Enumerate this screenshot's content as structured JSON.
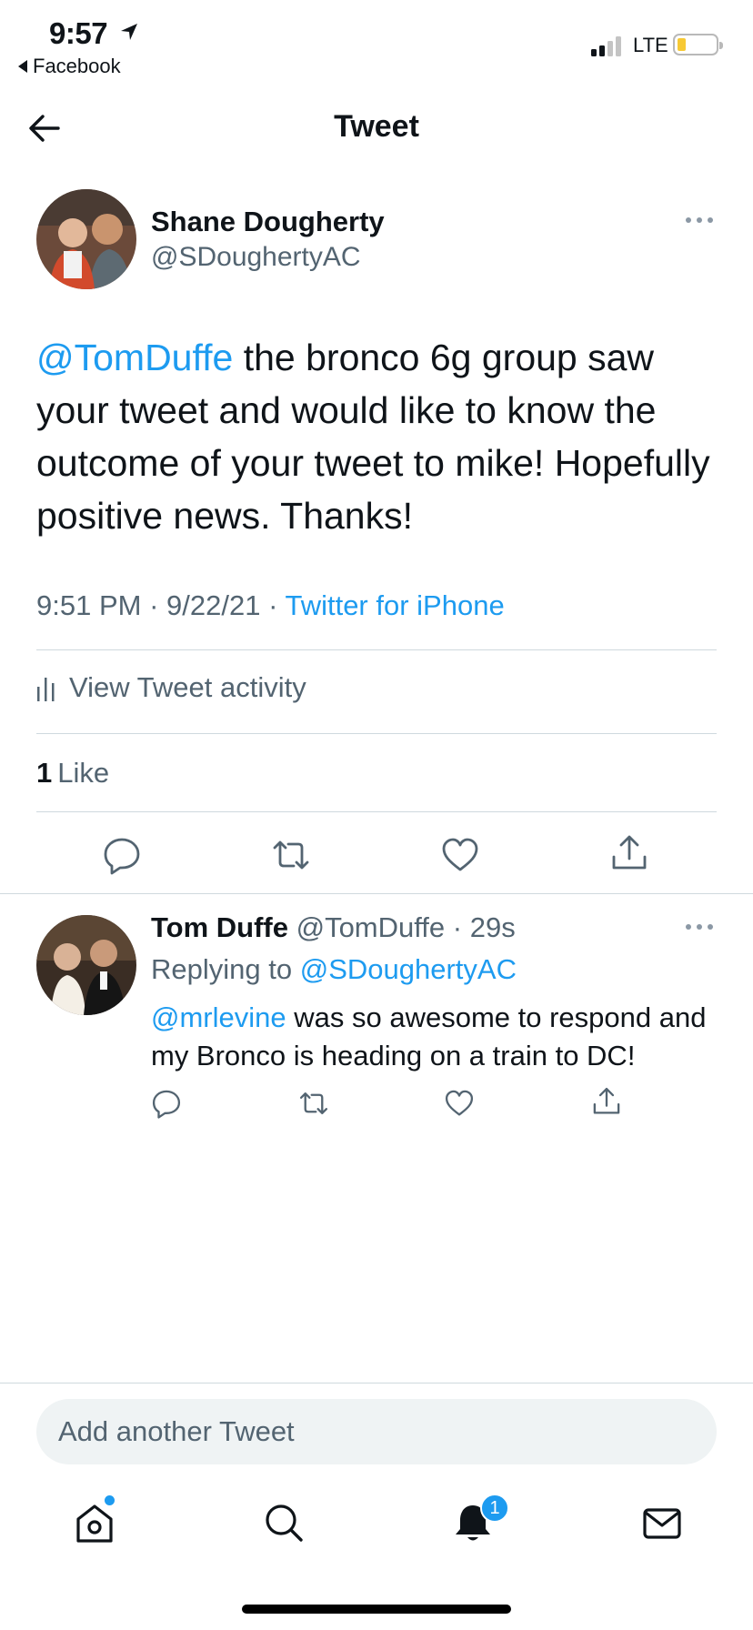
{
  "status_bar": {
    "time": "9:57",
    "back_app": "Facebook",
    "network": "LTE",
    "battery_level": 0.2,
    "battery_color": "#f7c934"
  },
  "nav": {
    "title": "Tweet",
    "back_icon": "arrow-left-icon"
  },
  "main_tweet": {
    "author_name": "Shane Dougherty",
    "author_handle": "@SDoughertyAC",
    "text_mention": "@TomDuffe",
    "text_body": " the bronco 6g group saw your tweet and would like to know the outcome of your tweet to mike! Hopefully positive news. Thanks!",
    "time": "9:51 PM",
    "date": "9/22/21",
    "source": "Twitter for iPhone",
    "activity_label": "View Tweet activity",
    "like_count": "1",
    "like_label": "Like"
  },
  "reply": {
    "author_name": "Tom Duffe",
    "author_handle": "@TomDuffe",
    "time": "29s",
    "replying_prefix": "Replying to ",
    "replying_to": "@SDoughertyAC",
    "text_mention": "@mrlevine",
    "text_body": " was so awesome to respond and my Bronco is heading on a train to DC!"
  },
  "compose": {
    "placeholder": "Add another Tweet"
  },
  "tab_bar": {
    "notification_count": "1",
    "accent": "#1d9bf0"
  },
  "colors": {
    "accent": "#1d9bf0",
    "secondary_text": "#536471",
    "divider": "#cfd9de"
  }
}
